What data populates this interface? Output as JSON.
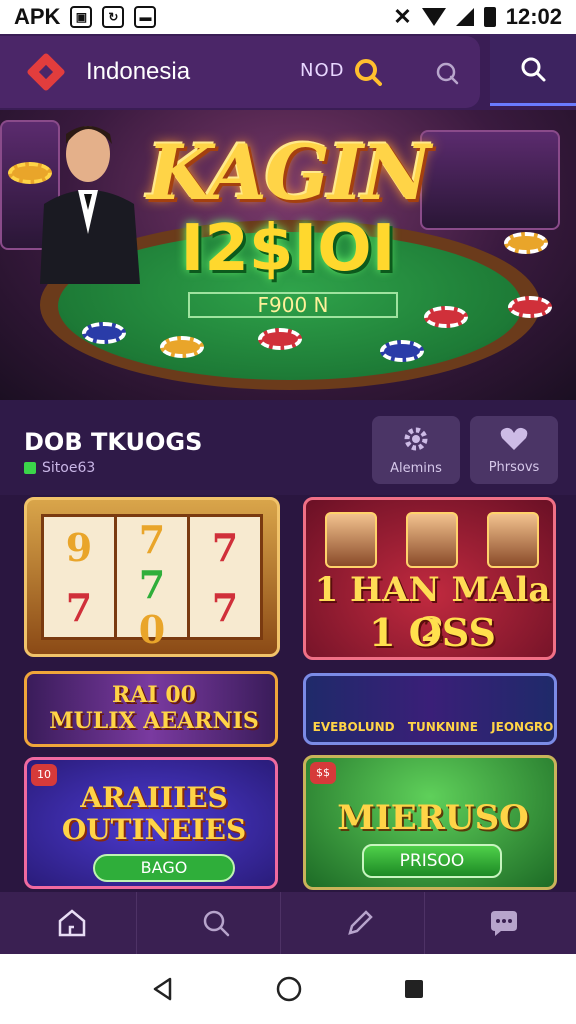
{
  "status_bar": {
    "left_label": "APK",
    "time": "12:02"
  },
  "header": {
    "brand": "Indonesia",
    "code": "NOD"
  },
  "hero": {
    "title": "KAGIN",
    "big_text": "I2$IOI",
    "sub_text": "F900 N"
  },
  "section": {
    "title": "DOB TKUOGS",
    "subtitle": "Sitoe63",
    "buttons": [
      {
        "label": "Alemins",
        "icon": "gear-icon"
      },
      {
        "label": "Phrsovs",
        "icon": "heart-icon"
      }
    ]
  },
  "cards": {
    "slot": {
      "reels": [
        [
          "9",
          "7",
          "7"
        ],
        [
          "7",
          "7",
          "7"
        ],
        [
          "7",
          "0",
          "7"
        ]
      ]
    },
    "ticket": {
      "line1": "1 HAN MAla 2",
      "line2": "1 OSS"
    },
    "banner1": {
      "line1": "RAI 00",
      "line2": "MULIX AEARNIS"
    },
    "banner2": {
      "labels": [
        "EVEBOLUND",
        "TUNKNINE",
        "JEONGRO"
      ]
    },
    "promo1": {
      "line1": "ARAIIIES",
      "line2": "OUTINEIES",
      "pill": "BAGO"
    },
    "promo2": {
      "title": "MIERUSO",
      "pill": "PRISOO"
    }
  },
  "bottom_nav": [
    "home-icon",
    "search-icon",
    "pencil-icon",
    "chat-icon"
  ],
  "system_nav": [
    "back-icon",
    "home-circle-icon",
    "recents-icon"
  ],
  "colors": {
    "accent": "#ffd447",
    "header": "#4b2668",
    "background": "#2a1640"
  }
}
